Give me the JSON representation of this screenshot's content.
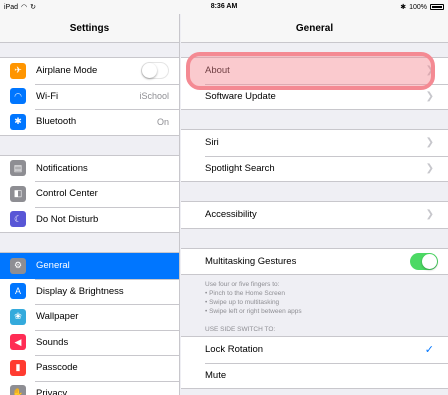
{
  "statusbar": {
    "device": "iPad",
    "time": "8:36 AM",
    "battery": "100%"
  },
  "master": {
    "title": "Settings",
    "groups": [
      [
        {
          "name": "airplane",
          "label": "Airplane Mode",
          "icon": "airplane-icon",
          "color": "#ff9500",
          "toggle": "off"
        },
        {
          "name": "wifi",
          "label": "Wi-Fi",
          "value": "iSchool",
          "icon": "wifi-icon",
          "color": "#0076ff"
        },
        {
          "name": "bluetooth",
          "label": "Bluetooth",
          "value": "On",
          "icon": "bluetooth-icon",
          "color": "#0076ff"
        }
      ],
      [
        {
          "name": "notifications",
          "label": "Notifications",
          "icon": "notifications-icon",
          "color": "#8e8e93"
        },
        {
          "name": "control-center",
          "label": "Control Center",
          "icon": "control-center-icon",
          "color": "#8e8e93"
        },
        {
          "name": "do-not-disturb",
          "label": "Do Not Disturb",
          "icon": "moon-icon",
          "color": "#5856d6"
        }
      ],
      [
        {
          "name": "general",
          "label": "General",
          "icon": "gear-icon",
          "color": "#8e8e93",
          "selected": true
        },
        {
          "name": "display",
          "label": "Display & Brightness",
          "icon": "display-icon",
          "color": "#0076ff"
        },
        {
          "name": "wallpaper",
          "label": "Wallpaper",
          "icon": "wallpaper-icon",
          "color": "#34aadc"
        },
        {
          "name": "sounds",
          "label": "Sounds",
          "icon": "sounds-icon",
          "color": "#ff2d55"
        },
        {
          "name": "passcode",
          "label": "Passcode",
          "icon": "lock-icon",
          "color": "#ff3b30"
        },
        {
          "name": "privacy",
          "label": "Privacy",
          "icon": "hand-icon",
          "color": "#8e8e93"
        }
      ]
    ]
  },
  "detail": {
    "title": "General",
    "group1": [
      {
        "label": "About"
      },
      {
        "label": "Software Update"
      }
    ],
    "group2": [
      {
        "label": "Siri"
      },
      {
        "label": "Spotlight Search"
      }
    ],
    "group3": [
      {
        "label": "Accessibility"
      }
    ],
    "group4": [
      {
        "label": "Multitasking Gestures",
        "toggle": "on"
      }
    ],
    "multitask_footer": [
      "Use four or five fingers to:",
      "• Pinch to the Home Screen",
      "• Swipe up to multitasking",
      "• Swipe left or right between apps"
    ],
    "side_switch_header": "USE SIDE SWITCH TO:",
    "group5": [
      {
        "label": "Lock Rotation",
        "checked": true
      },
      {
        "label": "Mute"
      }
    ]
  }
}
